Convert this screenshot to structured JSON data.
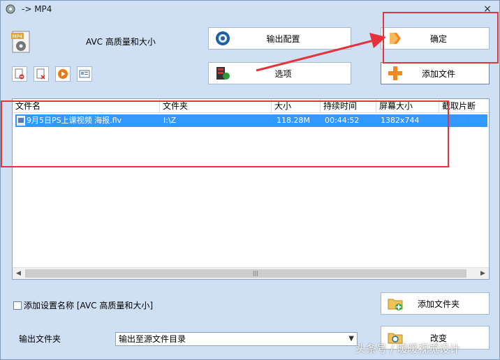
{
  "window": {
    "title": "-> MP4",
    "close_glyph": "×"
  },
  "format": {
    "icon_text": "MP4",
    "label": "AVC 高质量和大小"
  },
  "buttons": {
    "output_config": "输出配置",
    "confirm": "确定",
    "options": "选项",
    "add_file": "添加文件",
    "add_folder": "添加文件夹",
    "change": "改变"
  },
  "toolbar": {
    "icons": [
      "remove-file-icon",
      "clear-list-icon",
      "play-icon",
      "media-info-icon"
    ]
  },
  "file_list": {
    "columns": [
      "文件名",
      "文件夹",
      "大小",
      "持续时间",
      "屏幕大小",
      "截取片断"
    ],
    "rows": [
      {
        "name": "9月5日PS上课视频 海报.flv",
        "folder": "I:\\Z",
        "size": "118.28M",
        "duration": "00:44:52",
        "screen": "1382x744",
        "clip": ""
      }
    ]
  },
  "scroll": {
    "left_glyph": "◀",
    "right_glyph": "▶",
    "grip": "|||"
  },
  "add_setting_name": {
    "label": "添加设置名称 [AVC 高质量和大小]",
    "checked": false
  },
  "output_folder": {
    "label": "输出文件夹",
    "selected": "输出至源文件目录"
  },
  "watermark": "头条号 / 暖暖视觉设计",
  "colors": {
    "window_bg": "#cfe0f4",
    "selection": "#3399ff",
    "annotation_red": "#e5323b"
  }
}
